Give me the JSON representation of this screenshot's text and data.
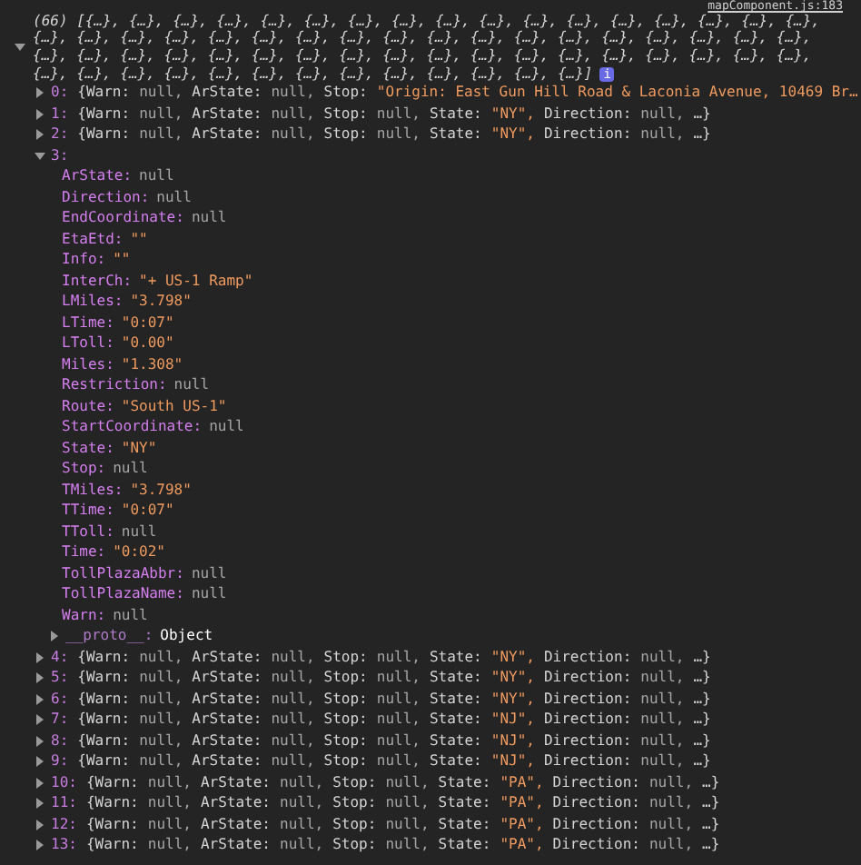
{
  "source_link": "mapComponent.js:183",
  "array": {
    "expanded": true,
    "preview_lines": [
      "(66) [{…}, {…}, {…}, {…}, {…}, {…}, {…}, {…}, {…}, {…}, {…}, {…}, {…}, {…}, {…}, {…}, {…},",
      "{…}, {…}, {…}, {…}, {…}, {…}, {…}, {…}, {…}, {…}, {…}, {…}, {…}, {…}, {…}, {…}, {…}, {…},",
      "{…}, {…}, {…}, {…}, {…}, {…}, {…}, {…}, {…}, {…}, {…}, {…}, {…}, {…}, {…}, {…}, {…}, {…},",
      "{…}, {…}, {…}, {…}, {…}, {…}, {…}, {…}, {…}, {…}, {…}, {…}, {…}]"
    ],
    "badge": "i"
  },
  "rows": [
    {
      "index": "0:",
      "expanded": false,
      "open": "{",
      "fields": [
        {
          "key": "Warn:",
          "value": "null,",
          "kind": "null"
        },
        {
          "key": "ArState:",
          "value": "null,",
          "kind": "null"
        },
        {
          "key": "Stop:",
          "value": "\"Origin: East Gun Hill Road & Laconia Avenue, 10469 Br…",
          "kind": "string"
        }
      ]
    },
    {
      "index": "1:",
      "expanded": false,
      "open": "{",
      "fields": [
        {
          "key": "Warn:",
          "value": "null,",
          "kind": "null"
        },
        {
          "key": "ArState:",
          "value": "null,",
          "kind": "null"
        },
        {
          "key": "Stop:",
          "value": "null,",
          "kind": "null"
        },
        {
          "key": "State:",
          "value": "\"NY\",",
          "kind": "string"
        },
        {
          "key": "Direction:",
          "value": "null,",
          "kind": "null"
        }
      ],
      "more": "…}"
    },
    {
      "index": "2:",
      "expanded": false,
      "open": "{",
      "fields": [
        {
          "key": "Warn:",
          "value": "null,",
          "kind": "null"
        },
        {
          "key": "ArState:",
          "value": "null,",
          "kind": "null"
        },
        {
          "key": "Stop:",
          "value": "null,",
          "kind": "null"
        },
        {
          "key": "State:",
          "value": "\"NY\",",
          "kind": "string"
        },
        {
          "key": "Direction:",
          "value": "null,",
          "kind": "null"
        }
      ],
      "more": "…}"
    },
    {
      "index": "3:",
      "expanded": true,
      "fields": [
        {
          "key": "ArState:",
          "value": "null",
          "kind": "null"
        },
        {
          "key": "Direction:",
          "value": "null",
          "kind": "null"
        },
        {
          "key": "EndCoordinate:",
          "value": "null",
          "kind": "null"
        },
        {
          "key": "EtaEtd:",
          "value": "\"\"",
          "kind": "string"
        },
        {
          "key": "Info:",
          "value": "\"\"",
          "kind": "string"
        },
        {
          "key": "InterCh:",
          "value": "\"+ US-1 Ramp\"",
          "kind": "string"
        },
        {
          "key": "LMiles:",
          "value": "\"3.798\"",
          "kind": "string"
        },
        {
          "key": "LTime:",
          "value": "\"0:07\"",
          "kind": "string"
        },
        {
          "key": "LToll:",
          "value": "\"0.00\"",
          "kind": "string"
        },
        {
          "key": "Miles:",
          "value": "\"1.308\"",
          "kind": "string"
        },
        {
          "key": "Restriction:",
          "value": "null",
          "kind": "null"
        },
        {
          "key": "Route:",
          "value": "\"South US-1\"",
          "kind": "string"
        },
        {
          "key": "StartCoordinate:",
          "value": "null",
          "kind": "null"
        },
        {
          "key": "State:",
          "value": "\"NY\"",
          "kind": "string"
        },
        {
          "key": "Stop:",
          "value": "null",
          "kind": "null"
        },
        {
          "key": "TMiles:",
          "value": "\"3.798\"",
          "kind": "string"
        },
        {
          "key": "TTime:",
          "value": "\"0:07\"",
          "kind": "string"
        },
        {
          "key": "TToll:",
          "value": "null",
          "kind": "null"
        },
        {
          "key": "Time:",
          "value": "\"0:02\"",
          "kind": "string"
        },
        {
          "key": "TollPlazaAbbr:",
          "value": "null",
          "kind": "null"
        },
        {
          "key": "TollPlazaName:",
          "value": "null",
          "kind": "null"
        },
        {
          "key": "Warn:",
          "value": "null",
          "kind": "null"
        }
      ],
      "proto": {
        "key": "__proto__:",
        "value": "Object",
        "expanded": false
      }
    },
    {
      "index": "4:",
      "expanded": false,
      "open": "{",
      "fields": [
        {
          "key": "Warn:",
          "value": "null,",
          "kind": "null"
        },
        {
          "key": "ArState:",
          "value": "null,",
          "kind": "null"
        },
        {
          "key": "Stop:",
          "value": "null,",
          "kind": "null"
        },
        {
          "key": "State:",
          "value": "\"NY\",",
          "kind": "string"
        },
        {
          "key": "Direction:",
          "value": "null,",
          "kind": "null"
        }
      ],
      "more": "…}"
    },
    {
      "index": "5:",
      "expanded": false,
      "open": "{",
      "fields": [
        {
          "key": "Warn:",
          "value": "null,",
          "kind": "null"
        },
        {
          "key": "ArState:",
          "value": "null,",
          "kind": "null"
        },
        {
          "key": "Stop:",
          "value": "null,",
          "kind": "null"
        },
        {
          "key": "State:",
          "value": "\"NY\",",
          "kind": "string"
        },
        {
          "key": "Direction:",
          "value": "null,",
          "kind": "null"
        }
      ],
      "more": "…}"
    },
    {
      "index": "6:",
      "expanded": false,
      "open": "{",
      "fields": [
        {
          "key": "Warn:",
          "value": "null,",
          "kind": "null"
        },
        {
          "key": "ArState:",
          "value": "null,",
          "kind": "null"
        },
        {
          "key": "Stop:",
          "value": "null,",
          "kind": "null"
        },
        {
          "key": "State:",
          "value": "\"NY\",",
          "kind": "string"
        },
        {
          "key": "Direction:",
          "value": "null,",
          "kind": "null"
        }
      ],
      "more": "…}"
    },
    {
      "index": "7:",
      "expanded": false,
      "open": "{",
      "fields": [
        {
          "key": "Warn:",
          "value": "null,",
          "kind": "null"
        },
        {
          "key": "ArState:",
          "value": "null,",
          "kind": "null"
        },
        {
          "key": "Stop:",
          "value": "null,",
          "kind": "null"
        },
        {
          "key": "State:",
          "value": "\"NJ\",",
          "kind": "string"
        },
        {
          "key": "Direction:",
          "value": "null,",
          "kind": "null"
        }
      ],
      "more": "…}"
    },
    {
      "index": "8:",
      "expanded": false,
      "open": "{",
      "fields": [
        {
          "key": "Warn:",
          "value": "null,",
          "kind": "null"
        },
        {
          "key": "ArState:",
          "value": "null,",
          "kind": "null"
        },
        {
          "key": "Stop:",
          "value": "null,",
          "kind": "null"
        },
        {
          "key": "State:",
          "value": "\"NJ\",",
          "kind": "string"
        },
        {
          "key": "Direction:",
          "value": "null,",
          "kind": "null"
        }
      ],
      "more": "…}"
    },
    {
      "index": "9:",
      "expanded": false,
      "open": "{",
      "fields": [
        {
          "key": "Warn:",
          "value": "null,",
          "kind": "null"
        },
        {
          "key": "ArState:",
          "value": "null,",
          "kind": "null"
        },
        {
          "key": "Stop:",
          "value": "null,",
          "kind": "null"
        },
        {
          "key": "State:",
          "value": "\"NJ\",",
          "kind": "string"
        },
        {
          "key": "Direction:",
          "value": "null,",
          "kind": "null"
        }
      ],
      "more": "…}"
    },
    {
      "index": "10:",
      "expanded": false,
      "open": "{",
      "fields": [
        {
          "key": "Warn:",
          "value": "null,",
          "kind": "null"
        },
        {
          "key": "ArState:",
          "value": "null,",
          "kind": "null"
        },
        {
          "key": "Stop:",
          "value": "null,",
          "kind": "null"
        },
        {
          "key": "State:",
          "value": "\"PA\",",
          "kind": "string"
        },
        {
          "key": "Direction:",
          "value": "null,",
          "kind": "null"
        }
      ],
      "more": "…}"
    },
    {
      "index": "11:",
      "expanded": false,
      "open": "{",
      "fields": [
        {
          "key": "Warn:",
          "value": "null,",
          "kind": "null"
        },
        {
          "key": "ArState:",
          "value": "null,",
          "kind": "null"
        },
        {
          "key": "Stop:",
          "value": "null,",
          "kind": "null"
        },
        {
          "key": "State:",
          "value": "\"PA\",",
          "kind": "string"
        },
        {
          "key": "Direction:",
          "value": "null,",
          "kind": "null"
        }
      ],
      "more": "…}"
    },
    {
      "index": "12:",
      "expanded": false,
      "open": "{",
      "fields": [
        {
          "key": "Warn:",
          "value": "null,",
          "kind": "null"
        },
        {
          "key": "ArState:",
          "value": "null,",
          "kind": "null"
        },
        {
          "key": "Stop:",
          "value": "null,",
          "kind": "null"
        },
        {
          "key": "State:",
          "value": "\"PA\",",
          "kind": "string"
        },
        {
          "key": "Direction:",
          "value": "null,",
          "kind": "null"
        }
      ],
      "more": "…}"
    },
    {
      "index": "13:",
      "expanded": false,
      "open": "{",
      "fields": [
        {
          "key": "Warn:",
          "value": "null,",
          "kind": "null"
        },
        {
          "key": "ArState:",
          "value": "null,",
          "kind": "null"
        },
        {
          "key": "Stop:",
          "value": "null,",
          "kind": "null"
        },
        {
          "key": "State:",
          "value": "\"PA\",",
          "kind": "string"
        },
        {
          "key": "Direction:",
          "value": "null,",
          "kind": "null"
        }
      ],
      "more": "…}"
    }
  ]
}
